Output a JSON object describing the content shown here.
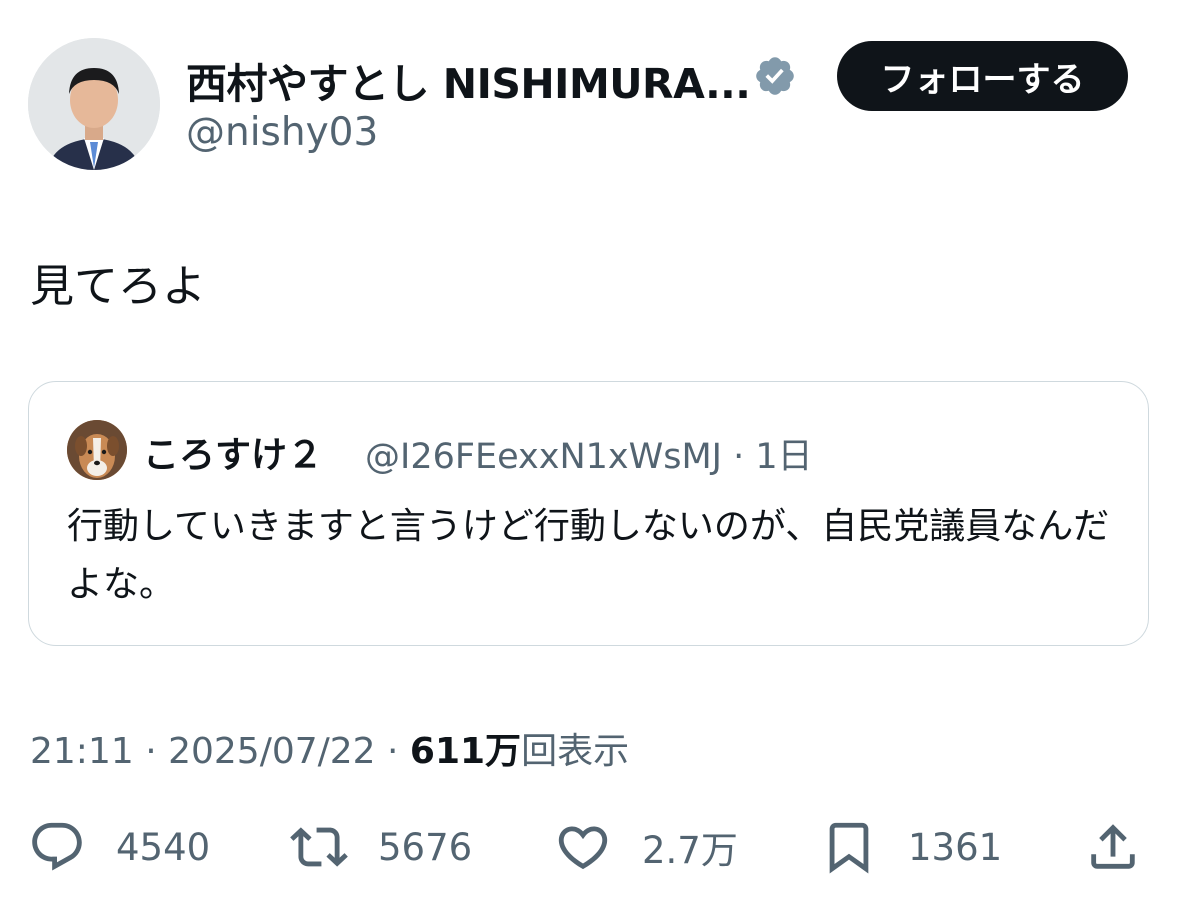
{
  "author": {
    "display_name": "西村やすとし NISHIMURA...",
    "handle": "@nishy03",
    "verified_icon": "verified-badge-icon",
    "follow_label": "フォローする"
  },
  "tweet": {
    "text": "見てろよ"
  },
  "quoted_tweet": {
    "display_name": "ころすけ２",
    "handle_time": "@I26FEexxN1xWsMJ · 1日",
    "text": "行動していきますと言うけど行動しないのが、自民党議員なんだよな。"
  },
  "meta": {
    "time_date": "21:11 · 2025/07/22 · ",
    "views_count": "611万",
    "views_label": "回表示"
  },
  "actions": {
    "reply_count": "4540",
    "retweet_count": "5676",
    "like_count": "2.7万",
    "bookmark_count": "1361"
  },
  "colors": {
    "text": "#0f1419",
    "secondary": "#536471",
    "border": "#cfd9de",
    "verified": "#829aab"
  }
}
